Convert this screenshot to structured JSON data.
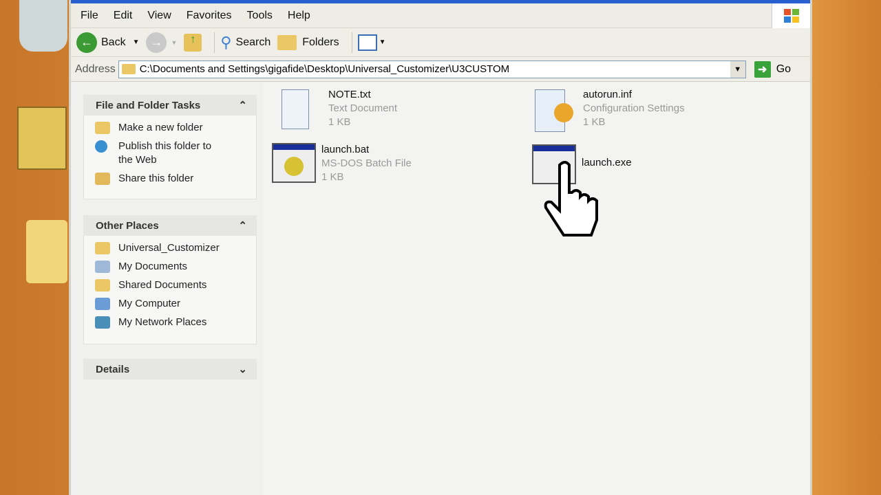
{
  "menu": [
    "File",
    "Edit",
    "View",
    "Favorites",
    "Tools",
    "Help"
  ],
  "toolbar": {
    "back": "Back",
    "search": "Search",
    "folders": "Folders"
  },
  "address": {
    "label": "Address",
    "path": "C:\\Documents and Settings\\gigafide\\Desktop\\Universal_Customizer\\U3CUSTOM",
    "go": "Go"
  },
  "tasks": {
    "title": "File and Folder Tasks",
    "items": [
      "Make a new folder",
      "Publish this folder to the Web",
      "Share this folder"
    ]
  },
  "places": {
    "title": "Other Places",
    "items": [
      "Universal_Customizer",
      "My Documents",
      "Shared Documents",
      "My Computer",
      "My Network Places"
    ]
  },
  "details": {
    "title": "Details"
  },
  "files": [
    {
      "name": "NOTE.txt",
      "type": "Text Document",
      "size": "1 KB"
    },
    {
      "name": "autorun.inf",
      "type": "Configuration Settings",
      "size": "1 KB"
    },
    {
      "name": "launch.bat",
      "type": "MS-DOS Batch File",
      "size": "1 KB"
    },
    {
      "name": "launch.exe"
    }
  ]
}
